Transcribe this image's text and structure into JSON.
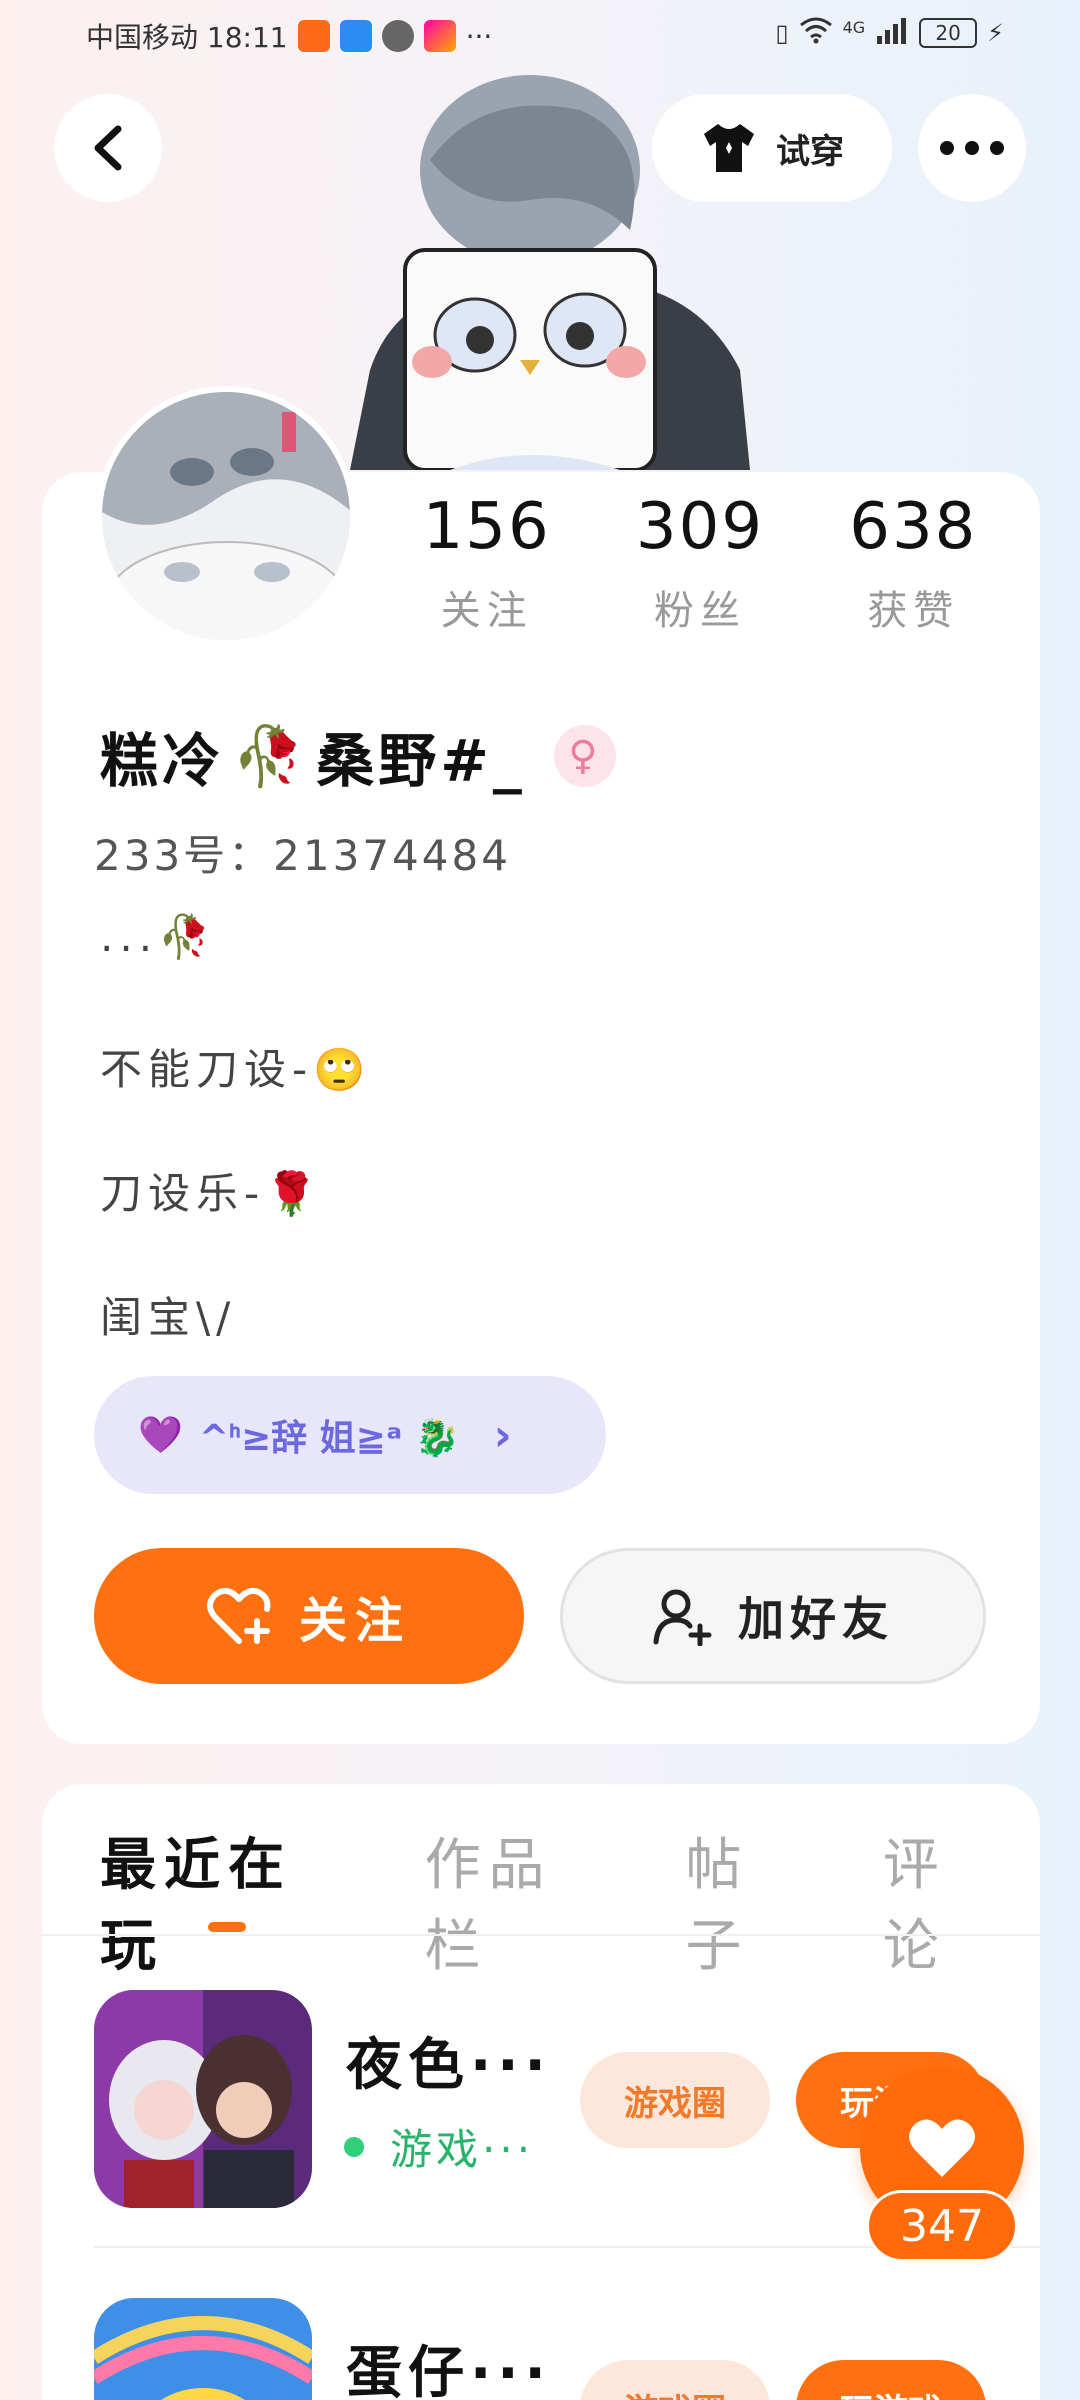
{
  "status_bar": {
    "carrier_time": "中国移动 18:11",
    "more": "···",
    "network": "4G",
    "battery": "20"
  },
  "header": {
    "tryon_label": "试穿"
  },
  "profile": {
    "stats": [
      {
        "value": "156",
        "label": "关注"
      },
      {
        "value": "309",
        "label": "粉丝"
      },
      {
        "value": "638",
        "label": "获赞"
      }
    ],
    "nickname_a": "糕冷",
    "nickname_emoji": "🥀",
    "nickname_b": "桑野#_",
    "gender_symbol": "♀",
    "uid": "233号：21374484",
    "bio": [
      "...🥀",
      "不能刀设-🙄",
      "刀设乐-🌹",
      "闺宝\\/"
    ],
    "tag": {
      "heart": "💜",
      "text": "^ᑋ≥辞 姐≧ᵃ 🐉",
      "chevron": "›"
    },
    "follow_label": "关注",
    "add_friend_label": "加好友"
  },
  "tabs": [
    "最近在玩",
    "作品栏",
    "帖子",
    "评论"
  ],
  "games": [
    {
      "name": "夜色···",
      "status": "游戏···",
      "circle_label": "游戏圈",
      "play_label": "玩游戏"
    },
    {
      "name": "蛋仔···",
      "status": "",
      "circle_label": "游戏圈",
      "play_label": "玩游戏"
    }
  ],
  "like_count": "347",
  "colors": {
    "accent": "#ff7010",
    "tag_bg": "#e7e6fb",
    "tag_text": "#6b68e0",
    "online": "#27b36a"
  }
}
